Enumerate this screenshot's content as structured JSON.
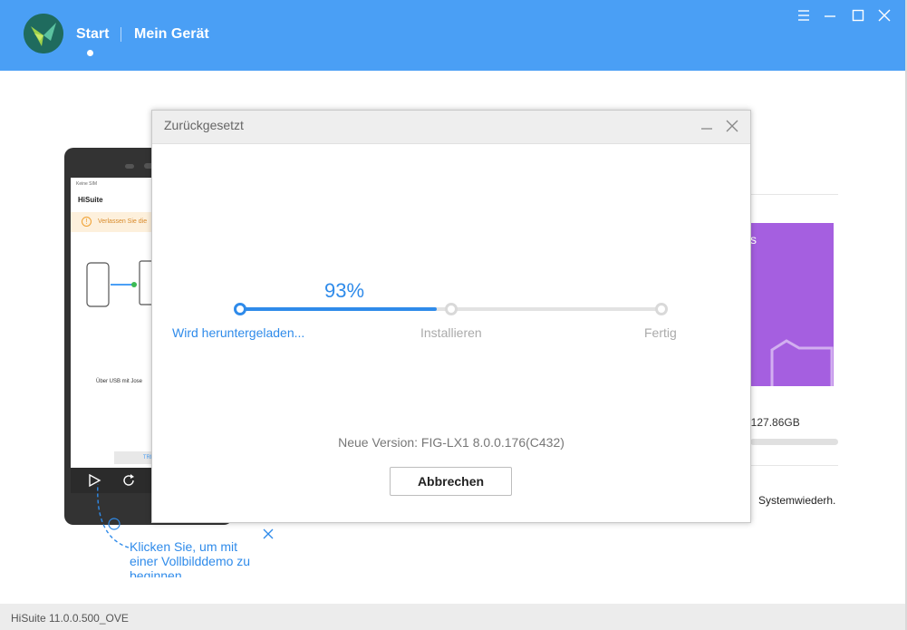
{
  "header": {
    "nav": [
      {
        "label": "Start",
        "active": true
      },
      {
        "label": "Mein Gerät",
        "active": false
      }
    ],
    "accent": "#4a9ff5"
  },
  "background": {
    "phone_screen": {
      "status": "Keine SIM",
      "app_title": "HiSuite",
      "warning": "Verlassen Sie die",
      "usb_text": "Über USB mit Jose",
      "trend_label": "TREN"
    },
    "coach_mark": "Klicken Sie, um mit einer Vollbilddemo zu beginnen",
    "right_panel_text": "s",
    "storage_text": ": 127.86GB",
    "system_restore": "Systemwiederh."
  },
  "dialog": {
    "title": "Zurückgesetzt",
    "percent_label": "93%",
    "progress": 0.93,
    "steps": [
      {
        "label": "Wird heruntergeladen...",
        "state": "active"
      },
      {
        "label": "Installieren",
        "state": "pending"
      },
      {
        "label": "Fertig",
        "state": "pending"
      }
    ],
    "version": "Neue Version: FIG-LX1 8.0.0.176(C432)",
    "cancel_label": "Abbrechen"
  },
  "footer": {
    "version": "HiSuite 11.0.0.500_OVE"
  },
  "colors": {
    "progress": "#2f8bea",
    "purple_tile": "#a55fe0",
    "inactive": "#d9d9d9"
  }
}
